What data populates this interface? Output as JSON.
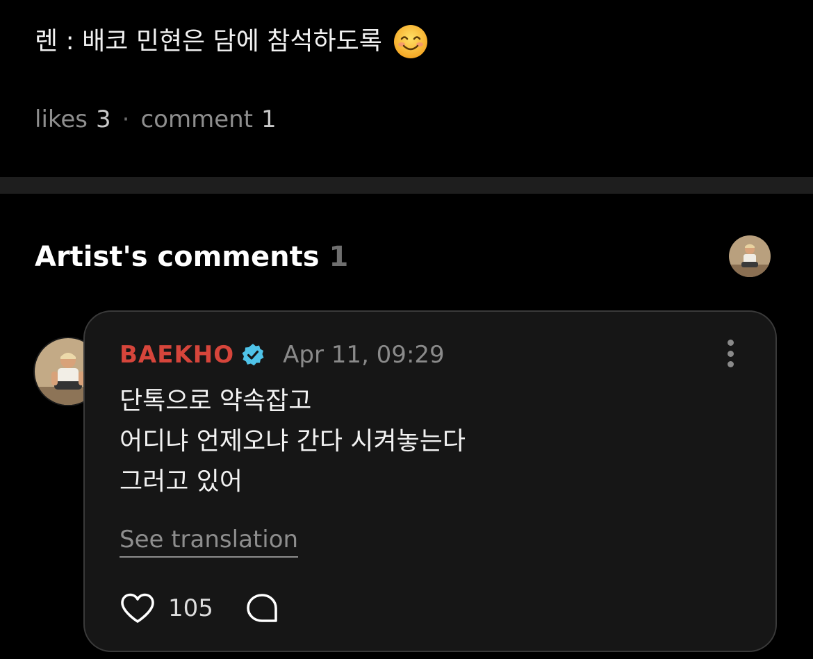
{
  "post": {
    "text": "렌 : 배코 민현은 담에 참석하도록",
    "emoji": "smiling-face-icon"
  },
  "stats": {
    "likes_label": "likes",
    "likes_count": "3",
    "separator": "·",
    "comment_label": "comment",
    "comment_count": "1"
  },
  "artist_comments": {
    "title": "Artist's comments",
    "count": "1"
  },
  "comment": {
    "author": "BAEKHO",
    "verified_icon": "verified-badge-icon",
    "timestamp": "Apr 11, 09:29",
    "lines": [
      "단톡으로 약속잡고",
      "어디냐 언제오냐 간다 시켜놓는다",
      "그러고 있어"
    ],
    "see_translation": "See translation",
    "like_count": "105"
  },
  "colors": {
    "background": "#000000",
    "card_background": "#161616",
    "author": "#d6453b",
    "verified": "#4fc3e8",
    "muted": "#8e8e8e"
  }
}
